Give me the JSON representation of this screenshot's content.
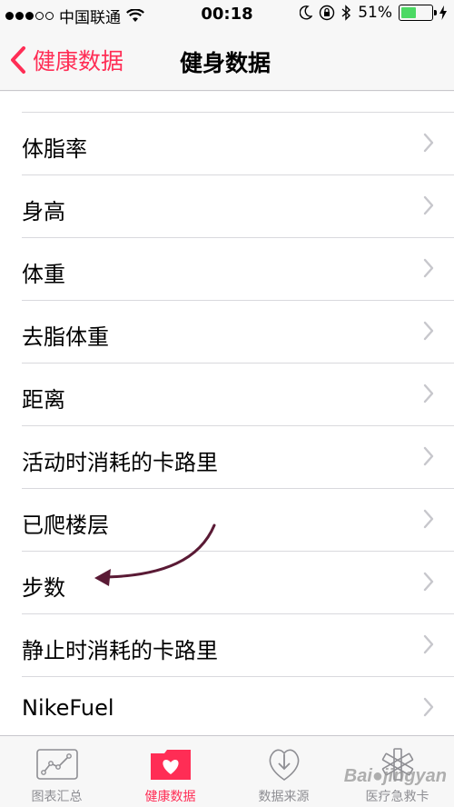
{
  "status_bar": {
    "carrier": "中国联通",
    "time": "00:18",
    "battery_percent": "51%",
    "battery_level": 0.51,
    "icons": [
      "signal-dots",
      "wifi-icon",
      "moon-icon",
      "orientation-lock-icon",
      "bluetooth-icon",
      "battery-icon",
      "charging-icon"
    ]
  },
  "nav": {
    "back_label": "健康数据",
    "title": "健身数据"
  },
  "list": {
    "items": [
      {
        "label": "体脂率"
      },
      {
        "label": "身高"
      },
      {
        "label": "体重"
      },
      {
        "label": "去脂体重"
      },
      {
        "label": "距离"
      },
      {
        "label": "活动时消耗的卡路里"
      },
      {
        "label": "已爬楼层"
      },
      {
        "label": "步数"
      },
      {
        "label": "静止时消耗的卡路里"
      },
      {
        "label": "NikeFuel"
      }
    ]
  },
  "tab_bar": {
    "tabs": [
      {
        "label": "图表汇总",
        "icon": "chart-icon",
        "active": false
      },
      {
        "label": "健康数据",
        "icon": "heart-folder-icon",
        "active": true
      },
      {
        "label": "数据来源",
        "icon": "download-heart-icon",
        "active": false
      },
      {
        "label": "医疗急救卡",
        "icon": "asterisk-icon",
        "active": false
      }
    ]
  },
  "colors": {
    "accent": "#ff2d55",
    "annotation_arrow": "#5a1a35",
    "inactive_tab": "#8e8e93",
    "battery": "#4cd964"
  }
}
